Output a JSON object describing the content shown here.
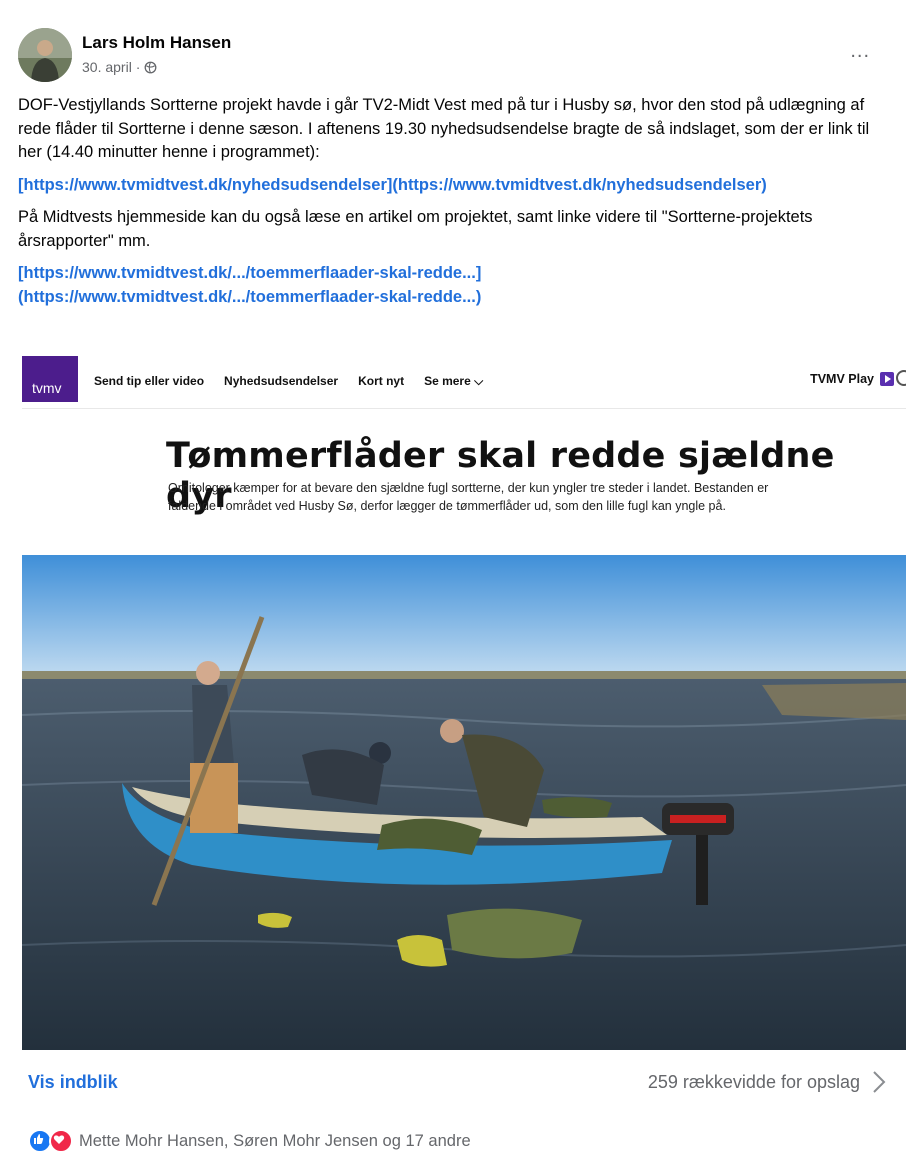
{
  "post": {
    "author": "Lars Holm Hansen",
    "date": "30. april ·",
    "more_label": "...",
    "paragraphs": [
      "DOF-Vestjyllands Sortterne projekt havde i går TV2-Midt Vest med på tur i Husby sø, hvor den stod på udlægning af rede flåder til Sortterne i denne sæson. I aftenens 19.30 nyhedsudsendelse bragte de så indslaget, som der er link til her (14.40 minutter henne i programmet):",
      "På Midtvests hjemmeside kan du også læse en artikel om projektet, samt linke videre til \"Sortterne-projektets årsrapporter\" mm."
    ],
    "link1_text": "[https://www.tvmidtvest.dk/nyhedsudsendelser](https://www.tvmidtvest.dk/nyhedsudsendelser)",
    "link2_line1": "[https://www.tvmidtvest.dk/.../toemmerflaader-skal-redde...]",
    "link2_line2": "(https://www.tvmidtvest.dk/.../toemmerflaader-skal-redde...)"
  },
  "embed": {
    "logo": "tvmv",
    "nav": [
      "Send tip eller video",
      "Nyhedsudsendelser",
      "Kort nyt",
      "Se mere ⌵"
    ],
    "play_label": "TVMV Play",
    "headline": "Tømmerflåder skal redde sjældne dyr",
    "subheadline": "Ornitologer kæmper for at bevare den sjældne fugl sortterne, der kun yngler tre steder i landet. Bestanden er faldende i området ved Husby Sø, derfor lægger de tømmerflåder ud, som den lille fugl kan yngle på."
  },
  "footer": {
    "insight_label": "Vis indblik",
    "reach_label": "259 rækkevidde for opslag",
    "reactions_text": "Mette Mohr Hansen, Søren Mohr Jensen og 17 andre"
  },
  "colors": {
    "link": "#216fdb",
    "tvmv_purple": "#4c1d8c",
    "like": "#1877f2",
    "love": "#f02849"
  },
  "icons": [
    "globe-icon",
    "more-icon",
    "chevron-right-icon",
    "like-reaction-icon",
    "love-reaction-icon",
    "search-icon",
    "play-icon"
  ]
}
